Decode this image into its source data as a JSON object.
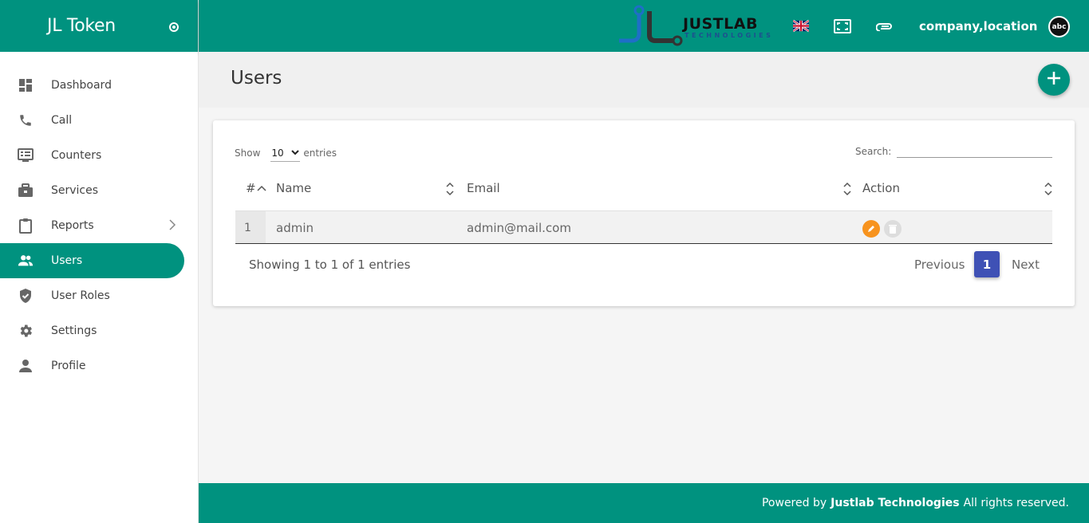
{
  "brand": {
    "title": "JL Token"
  },
  "sidebar": {
    "items": [
      {
        "label": "Dashboard",
        "icon": "dashboard-icon"
      },
      {
        "label": "Call",
        "icon": "phone-icon"
      },
      {
        "label": "Counters",
        "icon": "counter-icon"
      },
      {
        "label": "Services",
        "icon": "briefcase-icon"
      },
      {
        "label": "Reports",
        "icon": "clipboard-icon"
      },
      {
        "label": "Users",
        "icon": "users-icon"
      },
      {
        "label": "User Roles",
        "icon": "shield-icon"
      },
      {
        "label": "Settings",
        "icon": "gear-icon"
      },
      {
        "label": "Profile",
        "icon": "person-icon"
      }
    ],
    "active": "Users"
  },
  "topbar": {
    "logo_word": "JUSTLAB",
    "logo_sub": "TECHNOLOGIES",
    "company": "company,location",
    "avatar_text": "abc"
  },
  "page": {
    "title": "Users"
  },
  "table": {
    "show_label": "Show",
    "entries_label": "entries",
    "length_value": "10",
    "search_label": "Search:",
    "search_value": "",
    "columns": [
      "#",
      "Name",
      "Email",
      "Action"
    ],
    "rows": [
      {
        "index": "1",
        "name": "admin",
        "email": "admin@mail.com"
      }
    ],
    "info": "Showing 1 to 1 of 1 entries",
    "pagination": {
      "previous": "Previous",
      "current": "1",
      "next": "Next"
    }
  },
  "footer": {
    "prefix": "Powered by",
    "company": "Justlab Technologies",
    "suffix": "All rights reserved."
  },
  "colors": {
    "primary": "#00927f",
    "edit": "#f7931e",
    "page_active": "#3f51b5"
  }
}
